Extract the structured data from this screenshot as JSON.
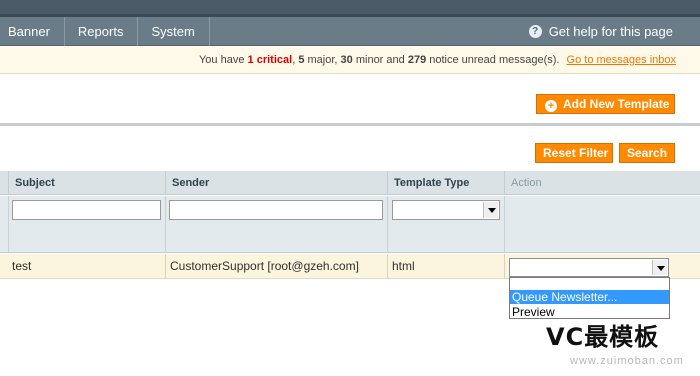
{
  "nav": {
    "items": [
      "Banner",
      "Reports",
      "System"
    ],
    "help_label": "Get help for this page",
    "help_icon": "help-icon"
  },
  "notice": {
    "prefix": "You have",
    "critical_count": "1",
    "critical_label": "critical",
    "major_count": "5",
    "major_label": "major,",
    "minor_count": "30",
    "minor_label": "minor and",
    "notice_count": "279",
    "notice_label": "notice unread message(s).",
    "link": "Go to messages inbox"
  },
  "buttons": {
    "add_new_template": "Add New Template",
    "reset_filter": "Reset Filter",
    "search": "Search"
  },
  "grid": {
    "columns": [
      "Subject",
      "Sender",
      "Template Type",
      "Action"
    ],
    "rows": [
      {
        "subject": "test",
        "sender": "CustomerSupport [root@gzeh.com]",
        "template_type": "html"
      }
    ],
    "action_options": [
      "",
      "Queue Newsletter...",
      "Preview"
    ],
    "highlighted_option": "Queue Newsletter..."
  },
  "watermark": {
    "main": "VC最模板",
    "sub": "www.zuimoban.com"
  },
  "colors": {
    "nav_bg": "#6a7c88",
    "topbar_bg": "#4a5a66",
    "accent_orange": "#ff8900",
    "notice_bg": "#fff9e9",
    "critical_red": "#dd0000",
    "header_bg": "#dbe2e6",
    "row_bg": "#fcf5dd",
    "selection_blue": "#3399ff"
  }
}
